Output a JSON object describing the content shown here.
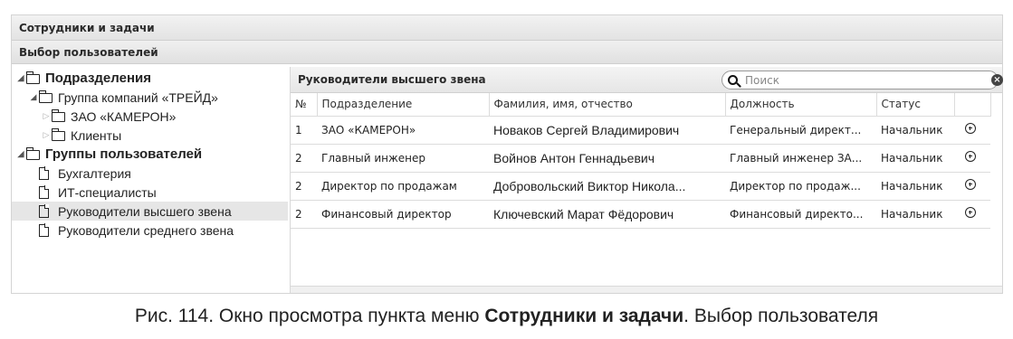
{
  "window": {
    "title": "Сотрудники и задачи",
    "subtitle": "Выбор пользователей"
  },
  "tree": [
    {
      "label": "Подразделения",
      "level": 0,
      "expanded": true,
      "bold": true,
      "icon": "folder-icon"
    },
    {
      "label": "Группа компаний «ТРЕЙД»",
      "level": 1,
      "expanded": true,
      "bold": false,
      "icon": "folder-icon"
    },
    {
      "label": "ЗАО «КАМЕРОН»",
      "level": 2,
      "expanded": false,
      "bold": false,
      "icon": "folder-icon"
    },
    {
      "label": "Клиенты",
      "level": 2,
      "expanded": false,
      "bold": false,
      "icon": "folder-icon"
    },
    {
      "label": "Группы пользователей",
      "level": 0,
      "expanded": true,
      "bold": true,
      "icon": "folder-icon"
    },
    {
      "label": "Бухгалтерия",
      "level": 1,
      "bold": false,
      "icon": "document-icon"
    },
    {
      "label": "ИТ-специалисты",
      "level": 1,
      "bold": false,
      "icon": "document-icon"
    },
    {
      "label": "Руководители высшего звена",
      "level": 1,
      "bold": false,
      "icon": "document-icon",
      "selected": true
    },
    {
      "label": "Руководители среднего звена",
      "level": 1,
      "bold": false,
      "icon": "document-icon"
    }
  ],
  "panel": {
    "title": "Руководители высшего звена",
    "search_placeholder": "Поиск",
    "columns": [
      "№",
      "Подразделение",
      "Фамилия, имя, отчество",
      "Должность",
      "Статус"
    ],
    "rows": [
      [
        "1",
        "ЗАО «КАМЕРОН»",
        "Новаков Сергей Владимирович",
        "Генеральный директ...",
        "Начальник"
      ],
      [
        "2",
        "Главный инженер",
        "Войнов Антон Геннадьевич",
        "Главный инженер ЗА...",
        "Начальник"
      ],
      [
        "2",
        "Директор по продажам",
        "Добровольский Виктор Никола...",
        "Директор по продаж...",
        "Начальник"
      ],
      [
        "2",
        "Финансовый директор",
        "Ключевский Марат Фёдорович",
        "Финансовый директо...",
        "Начальник"
      ]
    ]
  },
  "caption": {
    "prefix": "Рис. 114. Окно просмотра пункта меню ",
    "bold": "Сотрудники и задачи",
    "suffix": ". Выбор пользователя"
  }
}
